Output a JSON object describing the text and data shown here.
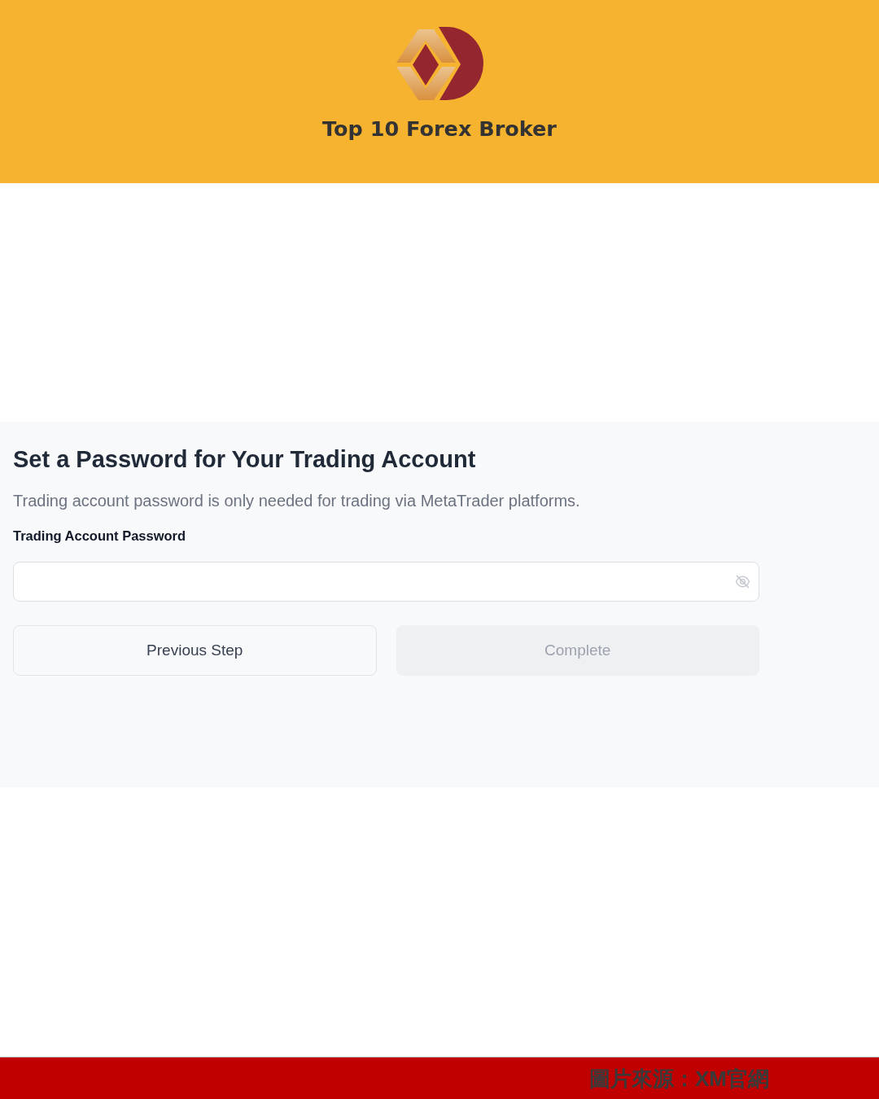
{
  "header": {
    "brand": "Top 10 Forex Broker"
  },
  "form": {
    "title": "Set a Password for Your Trading Account",
    "description": "Trading account password is only needed for trading via MetaTrader platforms.",
    "field": {
      "label": "Trading Account Password",
      "revealed": false
    },
    "buttons": [
      {
        "label": "Previous Step",
        "disabled": false
      },
      {
        "label": "Complete",
        "disabled": true
      }
    ]
  },
  "footer": {
    "caption": "圖片來源：XM官網"
  }
}
